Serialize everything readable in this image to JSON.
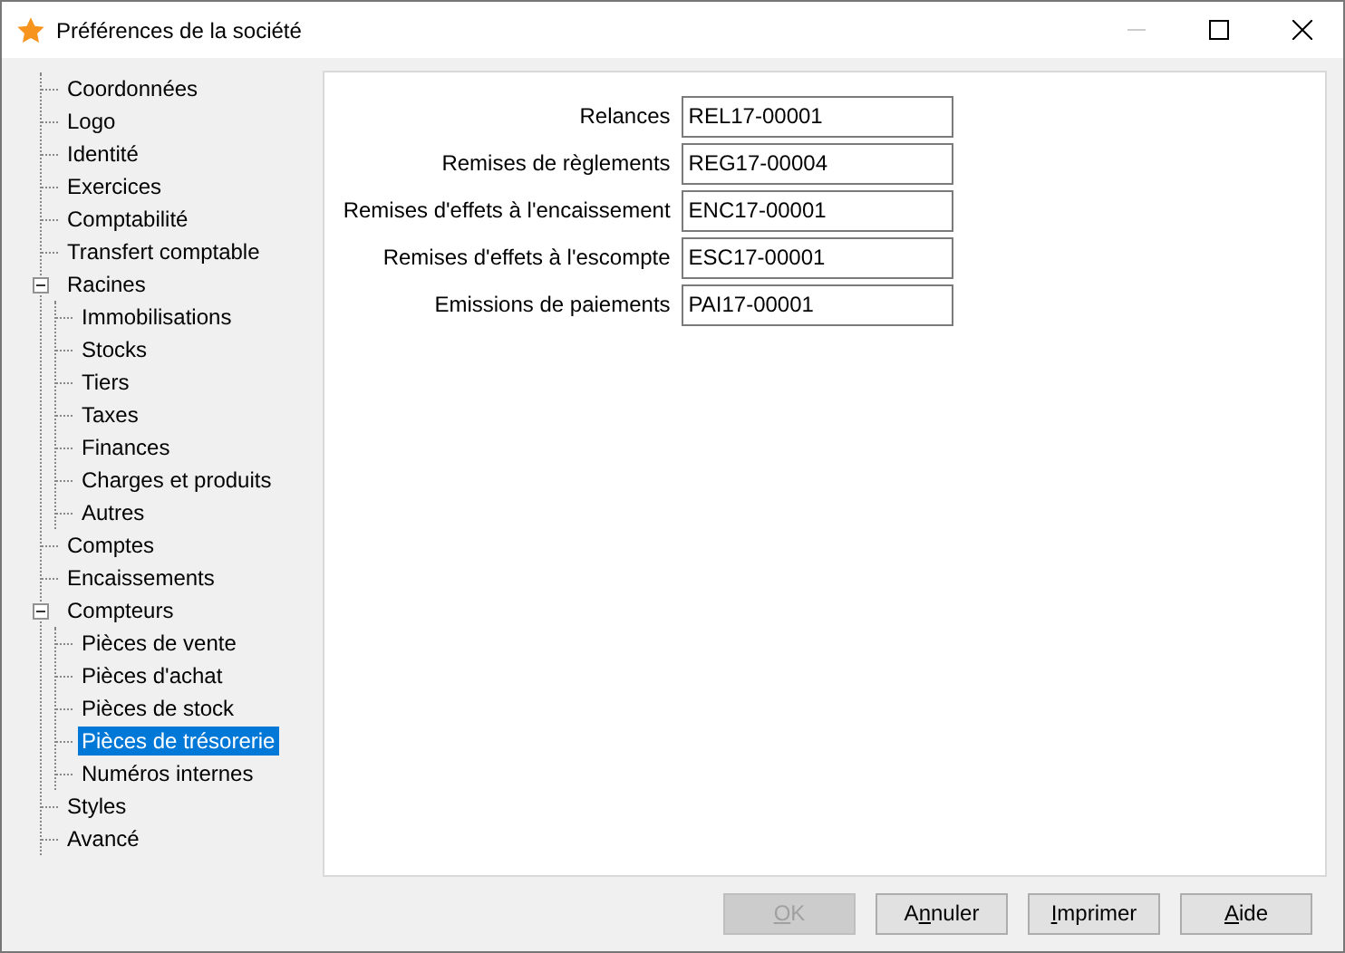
{
  "window": {
    "title": "Préférences de la société"
  },
  "tree": [
    {
      "label": "Coordonnées",
      "selected": false
    },
    {
      "label": "Logo",
      "selected": false
    },
    {
      "label": "Identité",
      "selected": false
    },
    {
      "label": "Exercices",
      "selected": false
    },
    {
      "label": "Comptabilité",
      "selected": false
    },
    {
      "label": "Transfert comptable",
      "selected": false
    },
    {
      "label": "Racines",
      "selected": false,
      "expanded": true,
      "children": [
        {
          "label": "Immobilisations",
          "selected": false
        },
        {
          "label": "Stocks",
          "selected": false
        },
        {
          "label": "Tiers",
          "selected": false
        },
        {
          "label": "Taxes",
          "selected": false
        },
        {
          "label": "Finances",
          "selected": false
        },
        {
          "label": "Charges et produits",
          "selected": false
        },
        {
          "label": "Autres",
          "selected": false
        }
      ]
    },
    {
      "label": "Comptes",
      "selected": false
    },
    {
      "label": "Encaissements",
      "selected": false
    },
    {
      "label": "Compteurs",
      "selected": false,
      "expanded": true,
      "children": [
        {
          "label": "Pièces de vente",
          "selected": false
        },
        {
          "label": "Pièces d'achat",
          "selected": false
        },
        {
          "label": "Pièces de stock",
          "selected": false
        },
        {
          "label": "Pièces de trésorerie",
          "selected": true
        },
        {
          "label": "Numéros internes",
          "selected": false
        }
      ]
    },
    {
      "label": "Styles",
      "selected": false
    },
    {
      "label": "Avancé",
      "selected": false
    }
  ],
  "fields": [
    {
      "label": "Relances",
      "value": "REL17-00001"
    },
    {
      "label": "Remises de règlements",
      "value": "REG17-00004"
    },
    {
      "label": "Remises d'effets à l'encaissement",
      "value": "ENC17-00001"
    },
    {
      "label": "Remises d'effets à l'escompte",
      "value": "ESC17-00001"
    },
    {
      "label": "Emissions de paiements",
      "value": "PAI17-00001"
    }
  ],
  "buttons": [
    {
      "key": "O",
      "after": "K",
      "disabled": true
    },
    {
      "before": "A",
      "key": "n",
      "after": "nuler",
      "disabled": false
    },
    {
      "key": "I",
      "after": "mprimer",
      "disabled": false
    },
    {
      "key": "A",
      "after": "ide",
      "disabled": false
    }
  ]
}
